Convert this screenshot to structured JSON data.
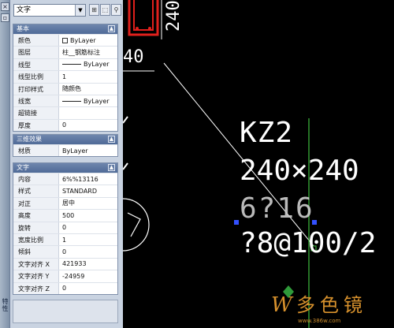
{
  "palette": {
    "object_type": "文字",
    "strip_label": "特性",
    "sections": [
      {
        "title": "基本",
        "rows": [
          {
            "name": "颜色",
            "value": "ByLayer",
            "kind": "color"
          },
          {
            "name": "图层",
            "value": "柱__钢筋标注",
            "kind": "text"
          },
          {
            "name": "线型",
            "value": "ByLayer",
            "kind": "linetype"
          },
          {
            "name": "线型比例",
            "value": "1",
            "kind": "text"
          },
          {
            "name": "打印样式",
            "value": "随颜色",
            "kind": "text"
          },
          {
            "name": "线宽",
            "value": "ByLayer",
            "kind": "linetype"
          },
          {
            "name": "超链接",
            "value": "",
            "kind": "text"
          },
          {
            "name": "厚度",
            "value": "0",
            "kind": "text"
          }
        ]
      },
      {
        "title": "三维效果",
        "rows": [
          {
            "name": "材质",
            "value": "ByLayer",
            "kind": "text"
          }
        ]
      },
      {
        "title": "文字",
        "rows": [
          {
            "name": "内容",
            "value": "6%%13116",
            "kind": "text"
          },
          {
            "name": "样式",
            "value": "STANDARD",
            "kind": "text"
          },
          {
            "name": "对正",
            "value": "居中",
            "kind": "text"
          },
          {
            "name": "高度",
            "value": "500",
            "kind": "text"
          },
          {
            "name": "旋转",
            "value": "0",
            "kind": "text"
          },
          {
            "name": "宽度比例",
            "value": "1",
            "kind": "text"
          },
          {
            "name": "倾斜",
            "value": "0",
            "kind": "text"
          },
          {
            "name": "文字对齐 X",
            "value": "421933",
            "kind": "text"
          },
          {
            "name": "文字对齐 Y",
            "value": "-24959",
            "kind": "text"
          },
          {
            "name": "文字对齐 Z",
            "value": "0",
            "kind": "text"
          }
        ]
      }
    ]
  },
  "canvas": {
    "dim_top": "240",
    "dim_left": "40",
    "column_name": "KZ2",
    "section_size": "240×240",
    "longitudinal_bars": "6?16",
    "stirrups": "?8@100/2",
    "colors": {
      "background": "#000000",
      "text": "#ffffff",
      "red_column": "#e0201c",
      "grip": "#3350ff",
      "leader": "#ffffff"
    }
  },
  "watermark": {
    "brand_chars": "W多色镜",
    "site": "www.386w.com"
  }
}
